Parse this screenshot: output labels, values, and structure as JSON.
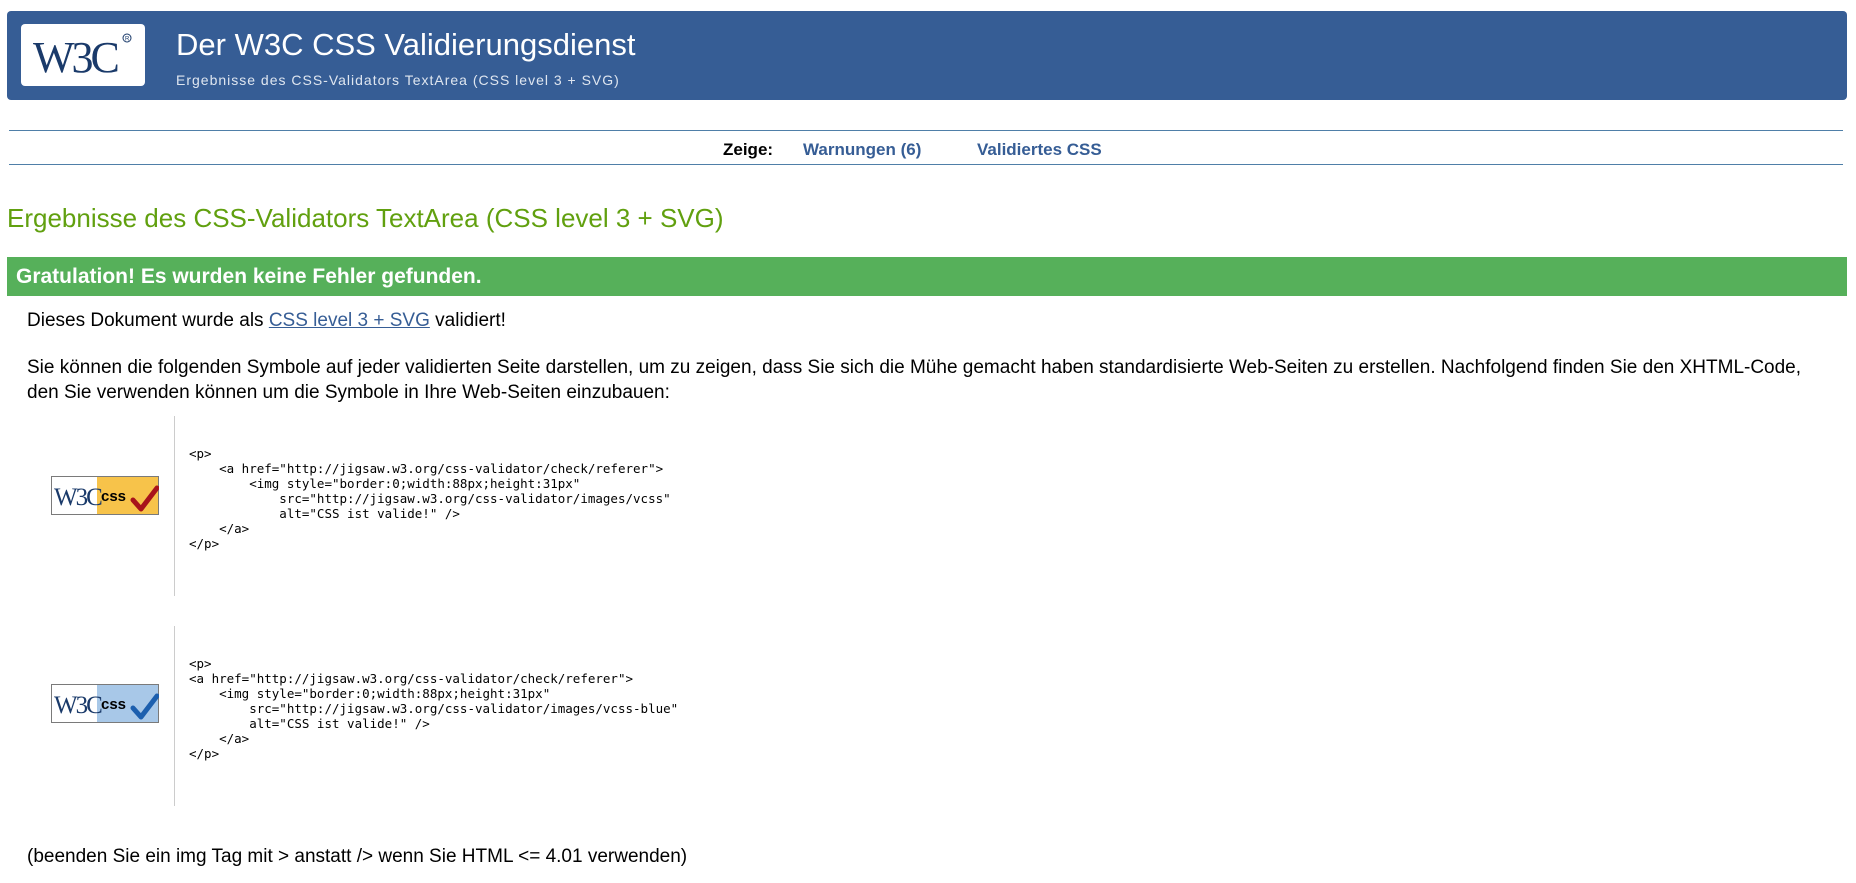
{
  "header": {
    "logo_text": "W3C",
    "title": "Der W3C CSS Validierungsdienst",
    "subtitle": "Ergebnisse des CSS-Validators TextArea (CSS level 3 + SVG)"
  },
  "nav": {
    "label": "Zeige:",
    "warnings_link": "Warnungen (6)",
    "validated_css_link": "Validiertes CSS"
  },
  "results": {
    "heading": "Ergebnisse des CSS-Validators TextArea (CSS level 3 + SVG)",
    "success_message": "Gratulation! Es wurden keine Fehler gefunden.",
    "validated_prefix": "Dieses Dokument wurde als ",
    "validated_link": "CSS level 3 + SVG",
    "validated_suffix": " validiert!",
    "symbols_text": "Sie können die folgenden Symbole auf jeder validierten Seite darstellen, um zu zeigen, dass Sie sich die Mühe gemacht haben standardisierte Web-Seiten zu erstellen. Nachfolgend finden Sie den XHTML-Code, den Sie verwenden können um die Symbole in Ihre Web-Seiten einzubauen:",
    "html_note": "(beenden Sie ein img Tag mit > anstatt /> wenn Sie HTML <= 4.01 verwenden)"
  },
  "badges": [
    {
      "logo_text": "W3C",
      "badge_text": "css",
      "code": "<p>\n    <a href=\"http://jigsaw.w3.org/css-validator/check/referer\">\n        <img style=\"border:0;width:88px;height:31px\"\n            src=\"http://jigsaw.w3.org/css-validator/images/vcss\"\n            alt=\"CSS ist valide!\" />\n    </a>\n</p>"
    },
    {
      "logo_text": "W3C",
      "badge_text": "css",
      "code": "<p>\n<a href=\"http://jigsaw.w3.org/css-validator/check/referer\">\n    <img style=\"border:0;width:88px;height:31px\"\n        src=\"http://jigsaw.w3.org/css-validator/images/vcss-blue\"\n        alt=\"CSS ist valide!\" />\n    </a>\n</p>"
    }
  ],
  "colors": {
    "header_blue": "#365d95",
    "heading_green": "#61a00f",
    "success_green": "#56b05a",
    "badge_gold": "#f7c34a",
    "badge_blue": "#a8c8e8",
    "check_red": "#a8131b",
    "check_blue": "#1c5fae"
  }
}
